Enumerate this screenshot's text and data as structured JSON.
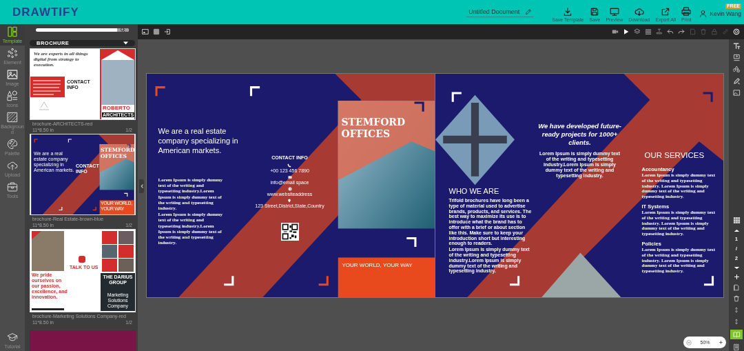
{
  "header": {
    "logo": "DRAWTIFY",
    "document_title": "Untitled Document",
    "actions": [
      {
        "kind": "download",
        "label": "Save Template"
      },
      {
        "kind": "save",
        "label": "Save"
      },
      {
        "kind": "preview",
        "label": "Preview"
      },
      {
        "kind": "cloud",
        "label": "Download"
      },
      {
        "kind": "export",
        "label": "Export All"
      },
      {
        "kind": "print",
        "label": "Print"
      }
    ],
    "user": {
      "name": "Kevin Wang",
      "badge": "FREE"
    }
  },
  "left_rail": {
    "items": [
      {
        "kind": "template",
        "label": "Template",
        "selected": true
      },
      {
        "kind": "element",
        "label": "Element",
        "selected": false
      },
      {
        "kind": "image",
        "label": "Image",
        "selected": false
      },
      {
        "kind": "icons",
        "label": "Icons",
        "selected": false
      },
      {
        "kind": "background",
        "label": "Background",
        "selected": false
      },
      {
        "kind": "palette",
        "label": "Palette",
        "selected": false
      },
      {
        "kind": "upload",
        "label": "Upload",
        "selected": false
      },
      {
        "kind": "tools",
        "label": "Tools",
        "selected": false
      }
    ],
    "tutorial": "Tutorial"
  },
  "template_panel": {
    "category": "BROCHURE",
    "templates": [
      {
        "kind": "architects",
        "name": "brochure-ARCHITECTS-red",
        "size": "11*8.50 in",
        "pages": "1/2",
        "texts": [
          "We are experts in all things digital from strategy to execution.",
          "CONTACT INFO",
          "ROBERTO",
          "ARCHITECTS"
        ]
      },
      {
        "kind": "real-estate",
        "name": "brochure-Real Estate-brown-blue",
        "size": "11*8.50 in",
        "pages": "1/2",
        "texts": [
          "We are a real estate company specializing in American markets.",
          "CONTACT INFO",
          "STEMFORD OFFICES",
          "YOUR WORLD, YOUR WAY"
        ]
      },
      {
        "kind": "marketing",
        "name": "brochure-Marketing Solutions Company-red",
        "size": "11*8.50 in",
        "pages": "1/2",
        "texts": [
          "TALK TO US",
          "We pride ourselves on our passion, excellence, and innovation.",
          "THE DARIUS GROUP",
          "Marketing Solutions Company"
        ]
      },
      {
        "kind": "partial"
      }
    ]
  },
  "canvas": {
    "pages": [
      {
        "kind": "outer",
        "headline": "We are a real estate company specializing in American markets.",
        "body": [
          "Lorem Ipsum is simply dummy text of the writing and typesetting industry.Lorem Ipsum is simply dummy text of the writing and typesetting industry.",
          "Lorem Ipsum is simply dummy text of the writing and typesetting industry.Lorem Ipsum is simply dummy text of the writing and typesetting industry."
        ],
        "contact": {
          "title": "CONTACT INFO",
          "lines": [
            {
              "kind": "phone",
              "text": "+00 123 456 7890"
            },
            {
              "kind": "email",
              "text": "info@email space"
            },
            {
              "kind": "web",
              "text": "www.websiteaddress"
            },
            {
              "kind": "location",
              "text": "123 Street,District,State,Country"
            }
          ]
        },
        "cover_title": "STEMFORD OFFICES",
        "tagline": "YOUR WORLD, YOUR WAY"
      },
      {
        "kind": "inner",
        "intro": {
          "headline": "We have developed future-ready projects for 1000+ clients.",
          "body": "Lorem Ipsum is simply dummy text of the writing and typesetting industry.Lorem Ipsum is simply dummy text of the writing and typesetting industry."
        },
        "about": {
          "title": "WHO WE ARE",
          "body": [
            "Trifold brochures have long been a type of material used to advertise brands, products, and services. The best way to maximize its use is to introduce what the brand has to offer with a brief or about section like this. Make sure to keep your introduction short but interesting enough to readers.",
            "Lorem Ipsum is simply dummy text of the writing and typesetting industry.Lorem Ipsum is simply dummy text of the writing and typesetting industry."
          ]
        },
        "services": {
          "title": "OUR SERVICES",
          "items": [
            {
              "name": "Accountancy",
              "text": "Lorem Ipsum is simply dummy text of the writing and typesetting industry. Lorem Ipsum is simply dummy text of the writing and typesetting industry."
            },
            {
              "name": "IT Systems",
              "text": "Lorem Ipsum is simply dummy text of the writing and typesetting industry. Lorem Ipsum is simply dummy text of the writing and typesetting industry."
            },
            {
              "name": "Policies",
              "text": "Lorem Ipsum is simply dummy text of the writing and typesetting industry. Lorem Ipsum is simply dummy text of the writing and typesetting industry."
            }
          ]
        }
      }
    ]
  },
  "page_indicator": {
    "current": "1",
    "separator": "/",
    "total": "2"
  },
  "zoom": {
    "value": "50%"
  }
}
